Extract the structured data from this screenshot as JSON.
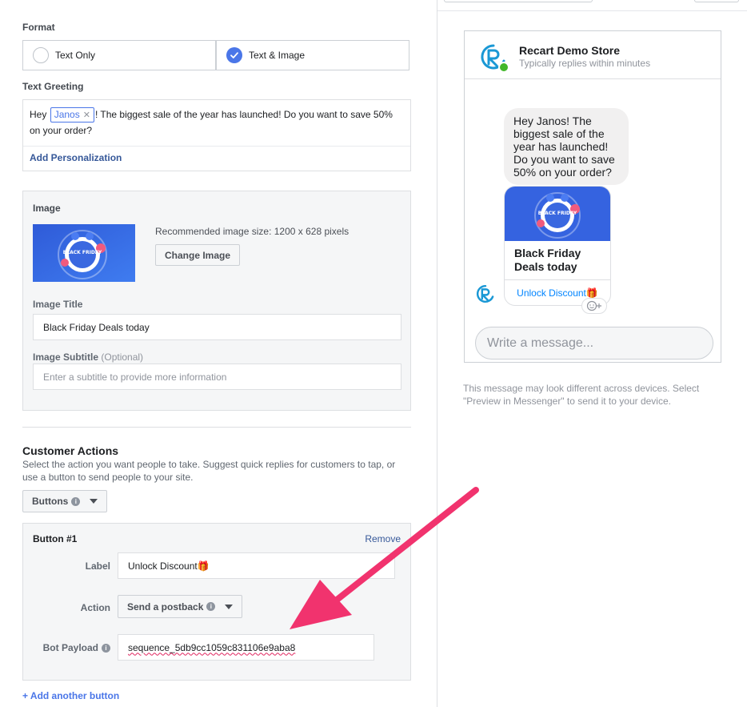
{
  "format": {
    "heading": "Format",
    "options": [
      {
        "label": "Text Only",
        "selected": false
      },
      {
        "label": "Text & Image",
        "selected": true
      }
    ]
  },
  "greeting": {
    "heading": "Text Greeting",
    "prefix": "Hey ",
    "token": "Janos",
    "suffix": "! The biggest sale of the year has launched! Do you want to save 50% on your order?",
    "add_personalization": "Add Personalization"
  },
  "image": {
    "heading": "Image",
    "banner_text": "BLACK FRIDAY",
    "recommended": "Recommended image size: 1200 x 628 pixels",
    "change_button": "Change Image",
    "title_label": "Image Title",
    "title_value": "Black Friday Deals today",
    "subtitle_label": "Image Subtitle",
    "subtitle_optional": "(Optional)",
    "subtitle_placeholder": "Enter a subtitle to provide more information"
  },
  "actions": {
    "heading": "Customer Actions",
    "description": "Select the action you want people to take. Suggest quick replies for customers to tap, or use a button to send people to your site.",
    "type_dropdown": "Buttons",
    "button1": {
      "title": "Button #1",
      "remove": "Remove",
      "label_label": "Label",
      "label_value": "Unlock Discount🎁",
      "action_label": "Action",
      "action_value": "Send a postback",
      "payload_label": "Bot Payload",
      "payload_value": "sequence_5db9cc1059c831106e9aba8"
    },
    "add_another": "+ Add another button"
  },
  "preview": {
    "store_name": "Recart Demo Store",
    "reply_time": "Typically replies within minutes",
    "message": "Hey Janos! The biggest sale of the year has launched! Do you want to save 50% on your order?",
    "card_title": "Black Friday Deals today",
    "card_button": "Unlock Discount🎁",
    "compose_placeholder": "Write a message...",
    "note": "This message may look different across devices. Select \"Preview in Messenger\" to send it to your device."
  },
  "colors": {
    "accent": "#4a76e8",
    "link": "#365899",
    "messenger_blue": "#0084ff",
    "online": "#42b72a",
    "annotation_arrow": "#f1336e"
  }
}
